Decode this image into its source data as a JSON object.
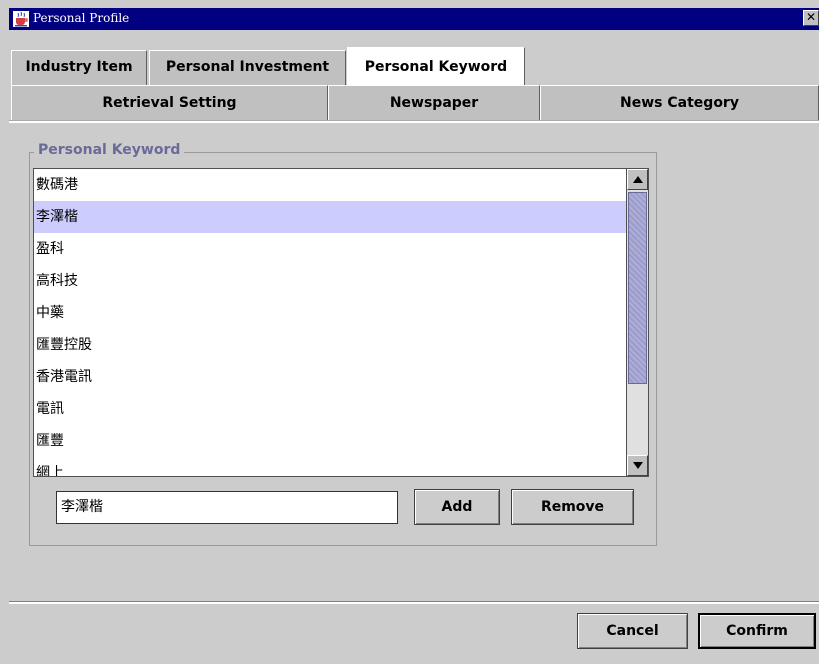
{
  "window": {
    "title": "Personal Profile"
  },
  "tabs_row1": [
    {
      "label": "Industry Item",
      "selected": false
    },
    {
      "label": "Personal Investment",
      "selected": false
    },
    {
      "label": "Personal Keyword",
      "selected": true
    }
  ],
  "tabs_row2": [
    {
      "label": "Retrieval Setting"
    },
    {
      "label": "Newspaper"
    },
    {
      "label": "News Category"
    }
  ],
  "keyword_group": {
    "title": "Personal Keyword",
    "items": [
      "數碼港",
      "李澤楷",
      "盈科",
      "高科技",
      "中藥",
      "匯豐控股",
      "香港電訊",
      "電訊",
      "匯豐",
      "網上"
    ],
    "selected_index": 1,
    "input_value": "李澤楷",
    "add_label": "Add",
    "remove_label": "Remove"
  },
  "footer": {
    "cancel_label": "Cancel",
    "confirm_label": "Confirm"
  },
  "colors": {
    "title_bar": "#000080",
    "selection": "#ccccff",
    "thumb": "#9c9ccc",
    "group_title": "#6a6a9a"
  }
}
